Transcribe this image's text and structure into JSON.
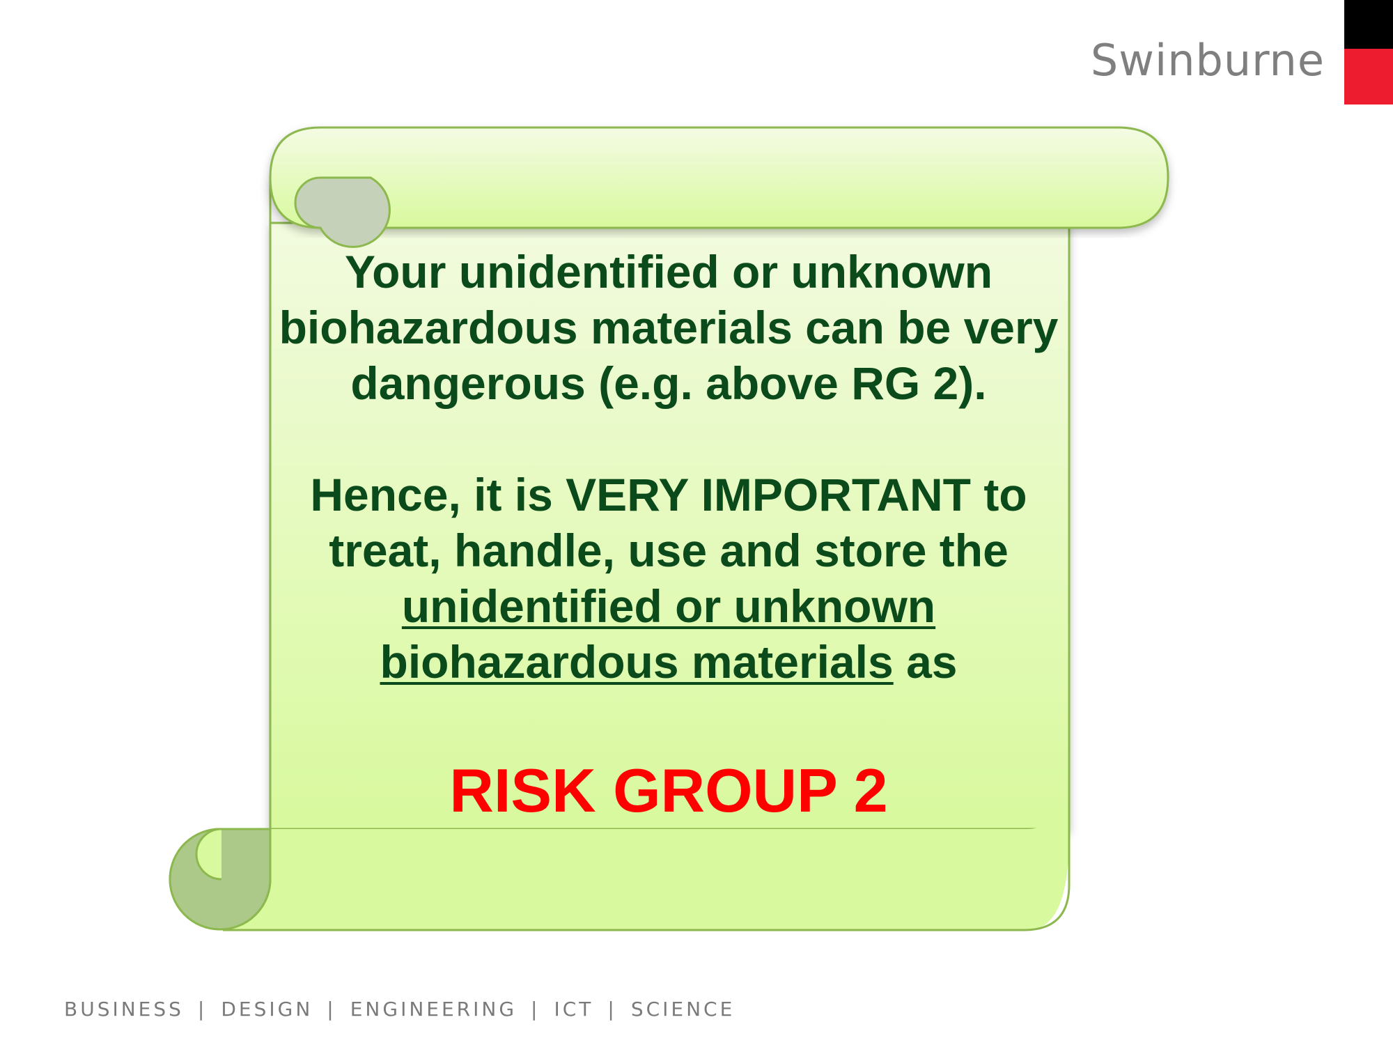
{
  "brand": {
    "name": "Swinburne",
    "colors": {
      "black": "#000000",
      "red": "#ed1c2e",
      "text": "#7f7f7f"
    }
  },
  "scroll": {
    "paragraph1": "Your unidentified or unknown biohazardous materials can be very dangerous (e.g. above RG 2).",
    "paragraph2_part1": "Hence, it is VERY IMPORTANT to treat, handle, use and store the",
    "paragraph2_underlined": "unidentified or unknown biohazardous materials",
    "paragraph2_part2": "as",
    "risk_group": "RISK GROUP 2",
    "colors": {
      "fill_top": "#f4fbe4",
      "fill_bottom": "#d8f99d",
      "border": "#8cb84e",
      "text": "#0b4a1b",
      "risk": "#ff0000"
    }
  },
  "footer": {
    "items": [
      "BUSINESS",
      "DESIGN",
      "ENGINEERING",
      "ICT",
      "SCIENCE"
    ],
    "separator": "|"
  }
}
